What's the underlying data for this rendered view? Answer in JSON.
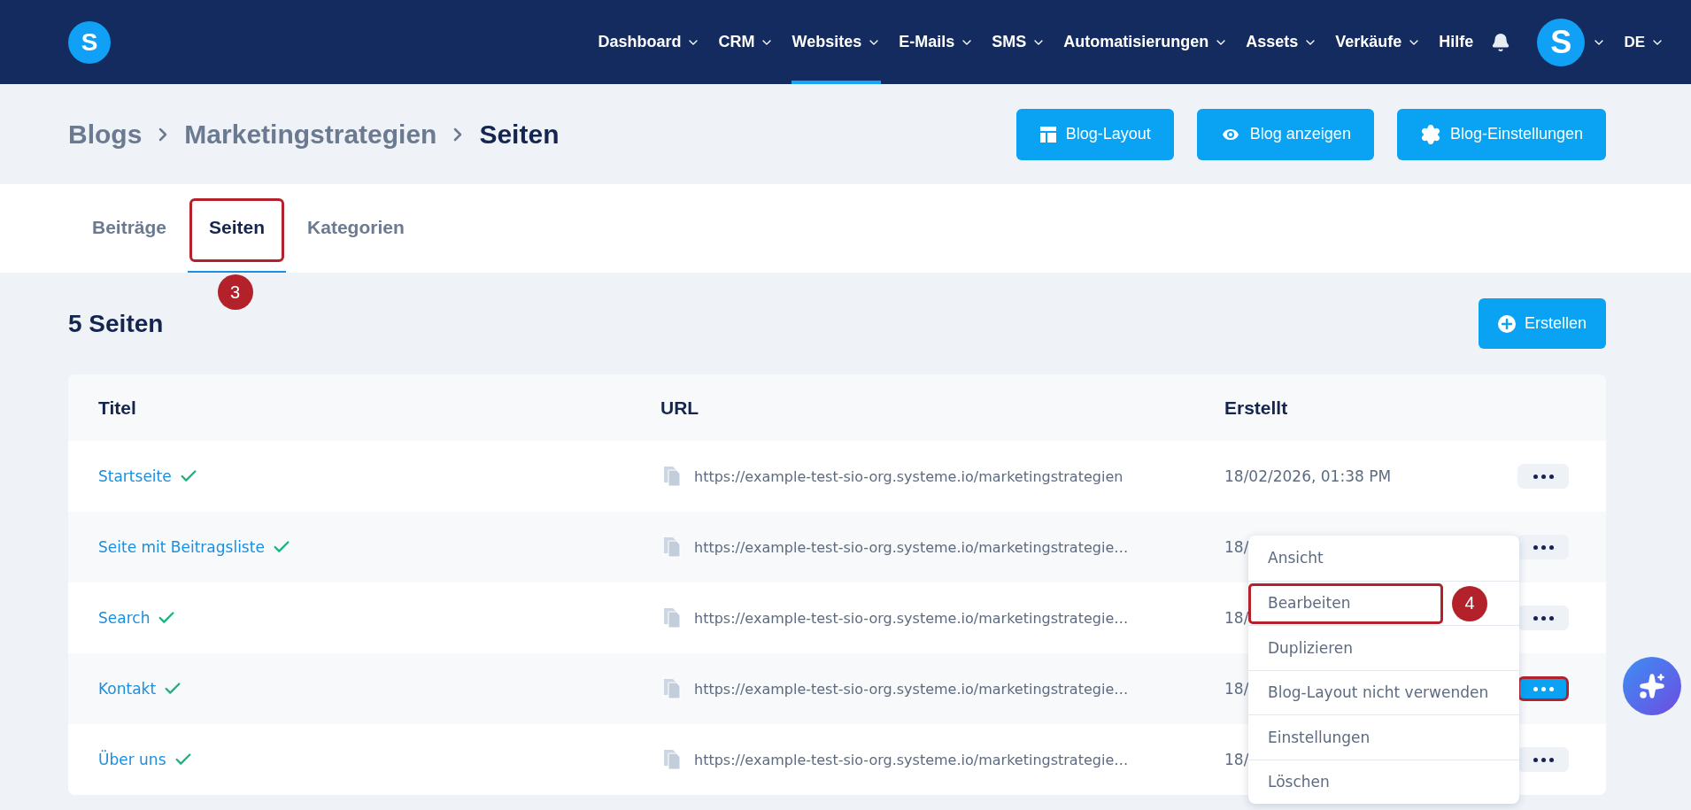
{
  "nav": {
    "logo": "S",
    "items": [
      {
        "label": "Dashboard",
        "dropdown": true,
        "selected": false
      },
      {
        "label": "CRM",
        "dropdown": true,
        "selected": false
      },
      {
        "label": "Websites",
        "dropdown": true,
        "selected": true
      },
      {
        "label": "E-Mails",
        "dropdown": true,
        "selected": false
      },
      {
        "label": "SMS",
        "dropdown": true,
        "selected": false
      },
      {
        "label": "Automatisierungen",
        "dropdown": true,
        "selected": false
      },
      {
        "label": "Assets",
        "dropdown": true,
        "selected": false
      },
      {
        "label": "Verkäufe",
        "dropdown": true,
        "selected": false
      },
      {
        "label": "Hilfe",
        "dropdown": false,
        "selected": false
      }
    ],
    "avatar": "S",
    "language": "DE"
  },
  "breadcrumb": [
    "Blogs",
    "Marketingstrategien",
    "Seiten"
  ],
  "header_buttons": [
    {
      "label": "Blog-Layout"
    },
    {
      "label": "Blog anzeigen"
    },
    {
      "label": "Blog-Einstellungen"
    }
  ],
  "tabs": [
    {
      "label": "Beiträge",
      "selected": false,
      "highlighted": false
    },
    {
      "label": "Seiten",
      "selected": true,
      "highlighted": true,
      "step": "3"
    },
    {
      "label": "Kategorien",
      "selected": false,
      "highlighted": false
    }
  ],
  "section_title": "5 Seiten",
  "create_button": "Erstellen",
  "table": {
    "columns": [
      "Titel",
      "URL",
      "Erstellt"
    ],
    "rows": [
      {
        "title": "Startseite",
        "published": true,
        "url": "https://example-test-sio-org.systeme.io/marketingstrategien",
        "created": "18/02/2026, 01:38 PM",
        "menu_open": false
      },
      {
        "title": "Seite mit Beitragsliste",
        "published": true,
        "url": "https://example-test-sio-org.systeme.io/marketingstrategie…",
        "created": "18/",
        "menu_open": false
      },
      {
        "title": "Search",
        "published": true,
        "url": "https://example-test-sio-org.systeme.io/marketingstrategie…",
        "created": "18/",
        "menu_open": false
      },
      {
        "title": "Kontakt",
        "published": true,
        "url": "https://example-test-sio-org.systeme.io/marketingstrategie…",
        "created": "18/",
        "menu_open": true
      },
      {
        "title": "Über uns",
        "published": true,
        "url": "https://example-test-sio-org.systeme.io/marketingstrategie…",
        "created": "18/",
        "menu_open": false
      }
    ]
  },
  "context_menu": {
    "items": [
      {
        "label": "Ansicht",
        "highlighted": false
      },
      {
        "label": "Bearbeiten",
        "highlighted": true,
        "step": "4"
      },
      {
        "label": "Duplizieren",
        "highlighted": false
      },
      {
        "label": "Blog-Layout nicht verwenden",
        "highlighted": false
      },
      {
        "label": "Einstellungen",
        "highlighted": false
      },
      {
        "label": "Löschen",
        "highlighted": false
      }
    ]
  }
}
